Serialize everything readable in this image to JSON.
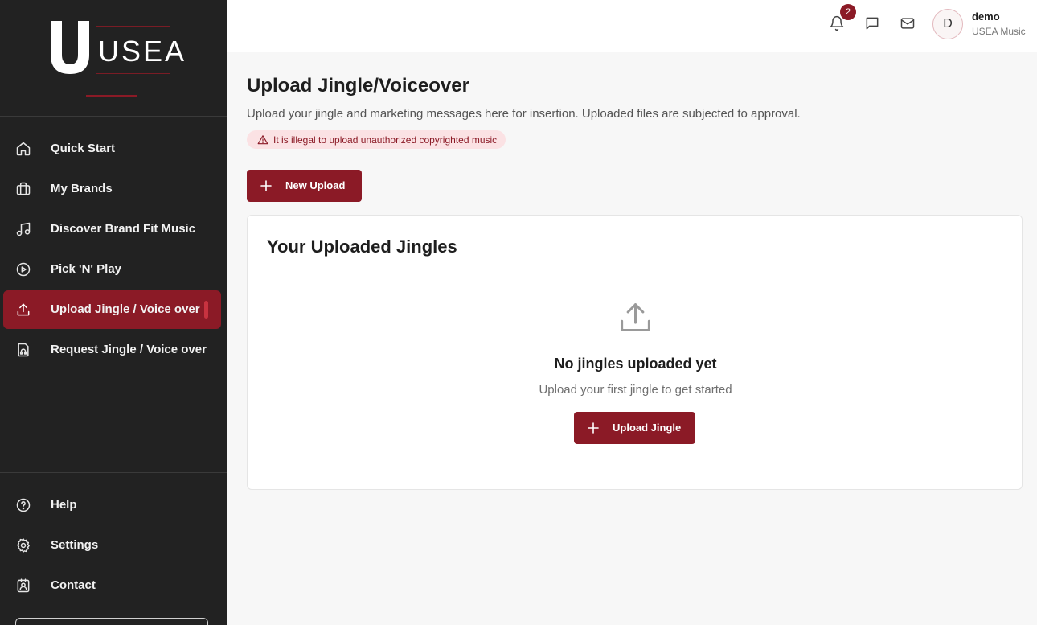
{
  "brand": {
    "logo_letter": "U",
    "logo_text": "USEA",
    "accent_color": "#8b1a26",
    "sidebar_bg": "#222222"
  },
  "sidebar": {
    "items": [
      {
        "label": "Quick Start",
        "icon": "home-icon"
      },
      {
        "label": "My Brands",
        "icon": "briefcase-icon"
      },
      {
        "label": "Discover Brand Fit Music",
        "icon": "music-note-icon"
      },
      {
        "label": "Pick 'N' Play",
        "icon": "play-circle-icon"
      },
      {
        "label": "Upload Jingle / Voice over",
        "icon": "upload-icon",
        "active": true
      },
      {
        "label": "Request Jingle / Voice over",
        "icon": "request-file-icon"
      }
    ],
    "bottom_items": [
      {
        "label": "Help",
        "icon": "help-circle-icon"
      },
      {
        "label": "Settings",
        "icon": "gear-icon"
      },
      {
        "label": "Contact",
        "icon": "contact-card-icon"
      }
    ]
  },
  "topbar": {
    "notification_count": "2",
    "icons": [
      "bell-icon",
      "chat-icon",
      "mail-icon"
    ],
    "user": {
      "avatar_initial": "D",
      "name": "demo",
      "org": "USEA Music"
    }
  },
  "page": {
    "title": "Upload Jingle/Voiceover",
    "description": "Upload your jingle and marketing messages here for insertion. Uploaded files are subjected to approval.",
    "warning": "It is illegal to upload unauthorized copyrighted music",
    "new_upload_label": "New Upload"
  },
  "card": {
    "title": "Your Uploaded Jingles",
    "empty_title": "No jingles uploaded yet",
    "empty_subtitle": "Upload your first jingle to get started",
    "upload_button_label": "Upload Jingle"
  }
}
